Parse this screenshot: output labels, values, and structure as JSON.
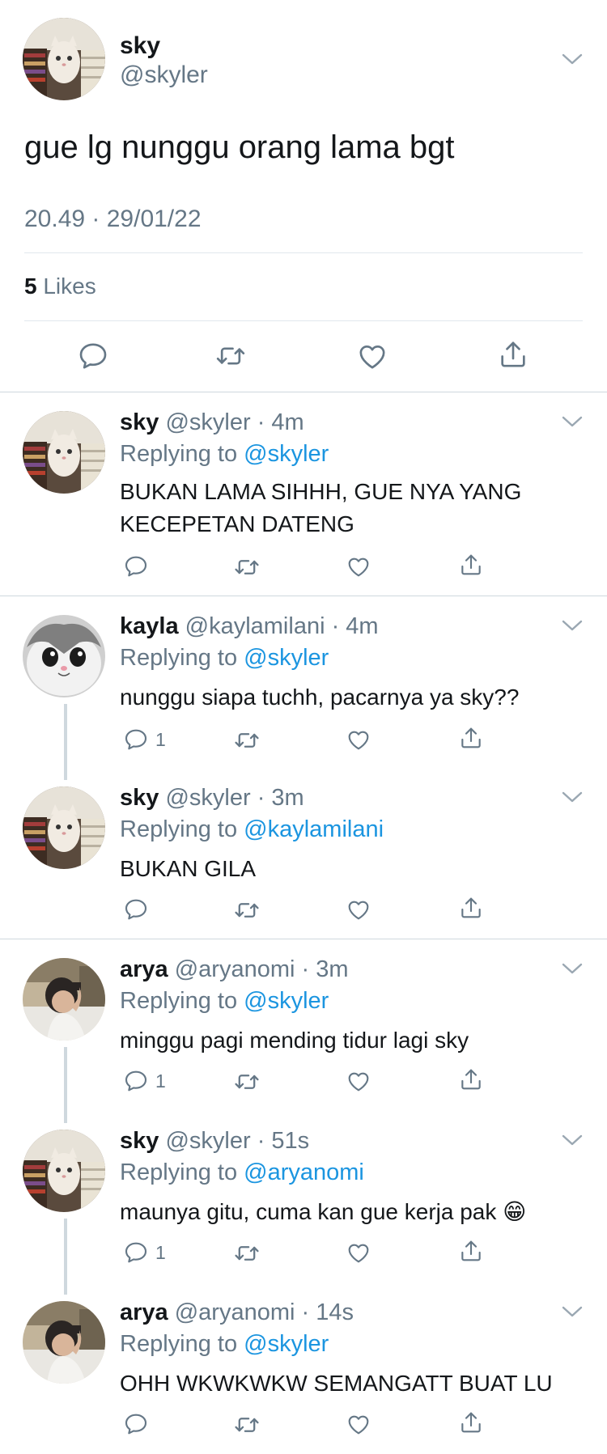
{
  "main": {
    "name": "sky",
    "handle": "@skyler",
    "text": "gue lg nunggu orang lama bgt",
    "timestamp": "20.49 · 29/01/22",
    "likes_count": "5",
    "likes_label": "Likes"
  },
  "replies": [
    {
      "name": "sky",
      "handle": "@skyler",
      "time": "· 4m",
      "reply_prefix": "Replying to ",
      "reply_to": "@skyler",
      "text": "BUKAN LAMA SIHHH, GUE NYA YANG KECEPETAN DATENG",
      "reply_count": ""
    },
    {
      "name": "kayla",
      "handle": "@kaylamilani",
      "time": "· 4m",
      "reply_prefix": "Replying to ",
      "reply_to": "@skyler",
      "text": "nunggu siapa tuchh, pacarnya ya sky??",
      "reply_count": "1"
    },
    {
      "name": "sky",
      "handle": "@skyler",
      "time": "· 3m",
      "reply_prefix": "Replying to ",
      "reply_to": "@kaylamilani",
      "text": "BUKAN GILA",
      "reply_count": ""
    },
    {
      "name": "arya",
      "handle": "@aryanomi",
      "time": "· 3m",
      "reply_prefix": "Replying to ",
      "reply_to": "@skyler",
      "text": "minggu pagi mending tidur lagi sky",
      "reply_count": "1"
    },
    {
      "name": "sky",
      "handle": "@skyler",
      "time": "· 51s",
      "reply_prefix": "Replying to ",
      "reply_to": "@aryanomi",
      "text": "maunya gitu, cuma kan gue kerja pak 😁",
      "reply_count": "1"
    },
    {
      "name": "arya",
      "handle": "@aryanomi",
      "time": "· 14s",
      "reply_prefix": "Replying to ",
      "reply_to": "@skyler",
      "text": "OHH WKWKWKW SEMANGATT BUAT LU",
      "reply_count": ""
    }
  ],
  "icons": {
    "reply": "reply-icon",
    "retweet": "retweet-icon",
    "like": "heart-icon",
    "share": "share-icon",
    "more": "chevron-down-icon"
  },
  "colors": {
    "link": "#1b95e0",
    "secondary_text": "#657786",
    "icon": "#657786"
  }
}
